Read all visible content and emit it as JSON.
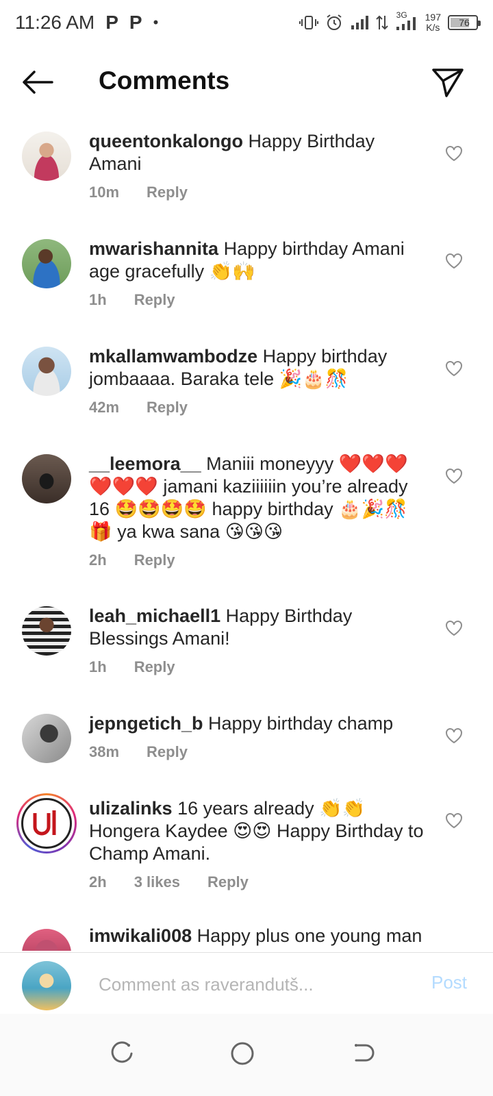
{
  "status_bar": {
    "time": "11:26 AM",
    "notif1": "P",
    "notif2": "P",
    "dot": "•",
    "network": "3G",
    "speed_value": "197",
    "speed_unit": "K/s",
    "battery": "76",
    "battery_level": 0.76
  },
  "header": {
    "title": "Comments"
  },
  "comments": [
    {
      "username": "queentonkalongo",
      "text": "Happy Birthday Amani",
      "time": "10m",
      "likes": "",
      "reply": "Reply"
    },
    {
      "username": "mwarishannita",
      "text": "Happy birthday Amani age gracefully 👏🙌",
      "time": "1h",
      "likes": "",
      "reply": "Reply"
    },
    {
      "username": "mkallamwambodze",
      "text": "Happy birthday jombaaaa. Baraka tele 🎉🎂🎊",
      "time": "42m",
      "likes": "",
      "reply": "Reply"
    },
    {
      "username": "__leemora__",
      "text": "Maniii moneyyy ❤️❤️❤️❤️❤️❤️ jamani kaziiiiiin you’re already 16 🤩🤩🤩🤩 happy birthday 🎂🎉🎊🎁 ya kwa sana 😘😘😘",
      "time": "2h",
      "likes": "",
      "reply": "Reply"
    },
    {
      "username": "leah_michaell1",
      "text": "Happy Birthday Blessings Amani!",
      "time": "1h",
      "likes": "",
      "reply": "Reply"
    },
    {
      "username": "jepngetich_b",
      "text": "Happy birthday champ",
      "time": "38m",
      "likes": "",
      "reply": "Reply"
    },
    {
      "username": "ulizalinks",
      "text": "16 years already 👏👏 Hongera Kaydee 😍😍 Happy Birthday to Champ Amani.",
      "time": "2h",
      "likes": "3 likes",
      "reply": "Reply"
    },
    {
      "username": "imwikali008",
      "text": "Happy plus one young man",
      "time": "",
      "likes": "",
      "reply": ""
    }
  ],
  "input": {
    "placeholder": "Comment as raverandutš...",
    "post_label": "Post"
  },
  "colors": {
    "text": "#262626",
    "meta": "#8e8e8e",
    "post_disabled": "#b3dbff"
  }
}
